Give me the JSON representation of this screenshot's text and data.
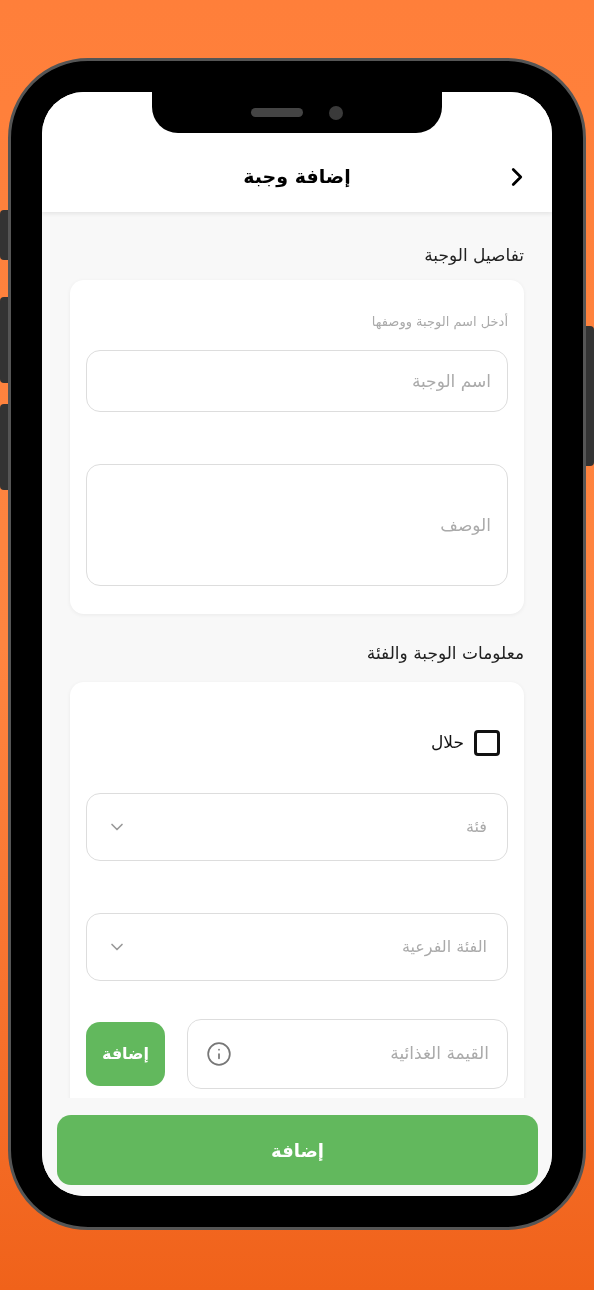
{
  "header": {
    "title": "إضافة وجبة"
  },
  "meal_details": {
    "title": "تفاصيل الوجبة",
    "hint": "أدخل اسم الوجبة ووصفها",
    "name_field": {
      "placeholder": "اسم الوجبة"
    },
    "description_field": {
      "placeholder": "الوصف"
    }
  },
  "meal_info": {
    "title": "معلومات الوجبة والفئة",
    "halal": {
      "label": "حلال",
      "checked": false
    },
    "dropdowns": [
      {
        "placeholder": "فئة"
      },
      {
        "placeholder": "الفئة الفرعية"
      }
    ],
    "nutrition_field": {
      "placeholder": "القيمة الغذائية"
    },
    "add_button": "إضافة"
  },
  "submit_button": "إضافة"
}
